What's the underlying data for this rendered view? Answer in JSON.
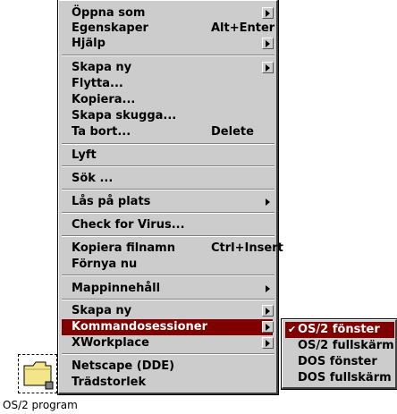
{
  "desktop": {
    "folder_label": "OS/2 program"
  },
  "context_menu": {
    "items": [
      {
        "label": "Öppna som"
      },
      {
        "label": "Egenskaper",
        "accel": "Alt+Enter"
      },
      {
        "label": "Hjälp"
      },
      {
        "label": "Skapa ny"
      },
      {
        "label": "Flytta..."
      },
      {
        "label": "Kopiera..."
      },
      {
        "label": "Skapa skugga..."
      },
      {
        "label": "Ta bort...",
        "accel": "Delete"
      },
      {
        "label": "Lyft"
      },
      {
        "label": "Sök ..."
      },
      {
        "label": "Lås på plats"
      },
      {
        "label": "Check for Virus..."
      },
      {
        "label": "Kopiera filnamn",
        "accel": "Ctrl+Insert"
      },
      {
        "label": "Förnya nu"
      },
      {
        "label": "Mappinnehåll"
      },
      {
        "label": "Skapa ny"
      },
      {
        "label": "Kommandosessioner"
      },
      {
        "label": "XWorkplace"
      },
      {
        "label": "Netscape (DDE)"
      },
      {
        "label": "Trädstorlek"
      }
    ]
  },
  "submenu": {
    "items": [
      {
        "label": "OS/2 fönster"
      },
      {
        "label": "OS/2 fullskärm"
      },
      {
        "label": "DOS fönster"
      },
      {
        "label": "DOS fullskärm"
      }
    ]
  },
  "colors": {
    "menu_bg": "#cccccc",
    "highlight": "#800000",
    "folder": "#f2e58a"
  }
}
